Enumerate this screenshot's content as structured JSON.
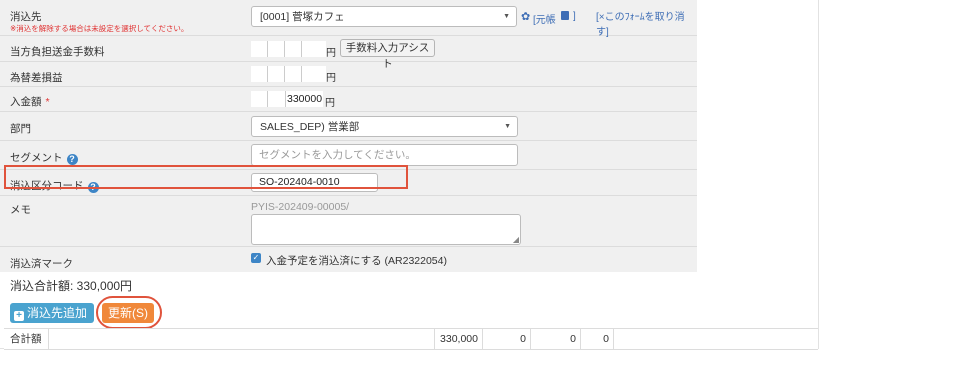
{
  "form": {
    "customer": {
      "label": "消込先",
      "note": "※消込を解除する場合は未設定を選択してください。",
      "value": "[0001] 菅塚カフェ",
      "ledger_link": "[元帳",
      "ledger_close": "]",
      "cancel_link": "[×このﾌｫｰﾑを取り消す]"
    },
    "transfer_fee": {
      "label": "当方負担送金手数料",
      "unit": "円",
      "assist_button": "手数料入力アシスト"
    },
    "fx_gain_loss": {
      "label": "為替差損益",
      "unit": "円"
    },
    "deposit": {
      "label": "入金額",
      "required_mark": "*",
      "value": "330000",
      "unit": "円"
    },
    "department": {
      "label": "部門",
      "value": "SALES_DEP) 営業部"
    },
    "segment": {
      "label": "セグメント",
      "placeholder": "セグメントを入力してください。"
    },
    "clearing_code": {
      "label": "消込区分コード",
      "value": "SO-202404-0010"
    },
    "memo": {
      "label": "メモ",
      "value": "PYIS-202409-00005/"
    },
    "cleared_mark": {
      "label": "消込済マーク",
      "checkbox_label": "入金予定を消込済にする (AR2322054)",
      "checked": true
    }
  },
  "summary": {
    "total_text": "消込合計額: 330,000円"
  },
  "buttons": {
    "add_label": "消込先追加",
    "update_label": "更新(S)"
  },
  "totals_row": {
    "label": "合計額",
    "values": [
      "330,000",
      "0",
      "0",
      "0"
    ]
  },
  "colors": {
    "accent_blue": "#4aa3cf",
    "update_orange": "#f0883a",
    "highlight_red": "#e0533c"
  }
}
